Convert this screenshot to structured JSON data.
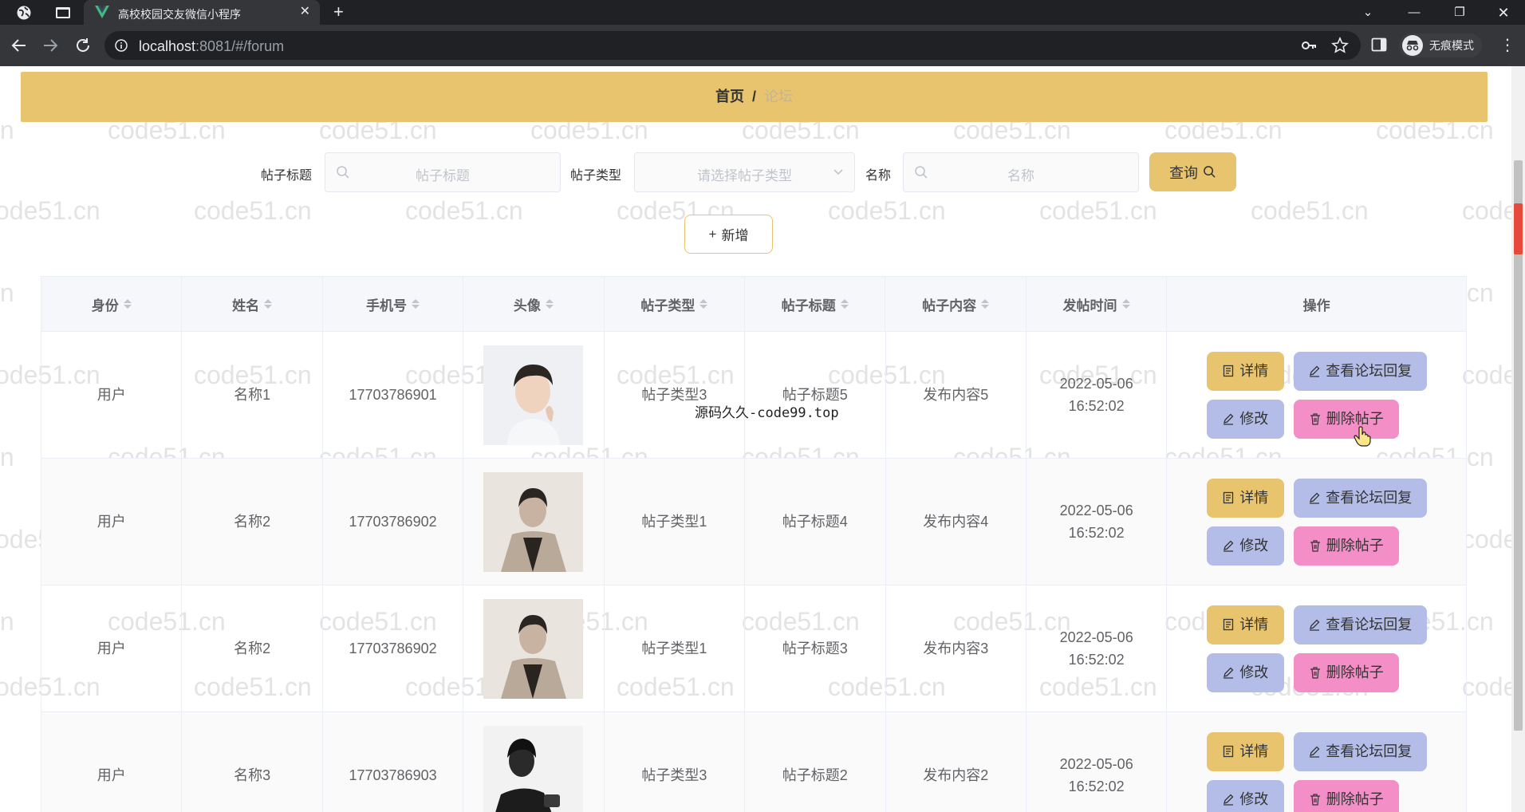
{
  "browser": {
    "tab_title": "高校校园交友微信小程序",
    "tab_close": "✕",
    "new_tab": "+",
    "url_host": "localhost",
    "url_path": ":8081/#/forum",
    "incognito_label": "无痕模式",
    "accent_color": "#42b883"
  },
  "breadcrumb": {
    "home": "首页",
    "separator": "/",
    "current": "论坛"
  },
  "search": {
    "title_label": "帖子标题",
    "title_placeholder": "帖子标题",
    "type_label": "帖子类型",
    "type_placeholder": "请选择帖子类型",
    "name_label": "名称",
    "name_placeholder": "名称",
    "query_button": "查询"
  },
  "toolbar": {
    "add_button": "新增",
    "add_icon": "+"
  },
  "table": {
    "columns": [
      "身份",
      "姓名",
      "手机号",
      "头像",
      "帖子类型",
      "帖子标题",
      "帖子内容",
      "发帖时间",
      "操作"
    ],
    "rows": [
      {
        "role": "用户",
        "name": "名称1",
        "phone": "17703786901",
        "avatar": "portrait-light",
        "post_type": "帖子类型3",
        "post_title": "帖子标题5",
        "post_content": "发布内容5",
        "post_time": "2022-05-06 16:52:02"
      },
      {
        "role": "用户",
        "name": "名称2",
        "phone": "17703786902",
        "avatar": "portrait-coat",
        "post_type": "帖子类型1",
        "post_title": "帖子标题4",
        "post_content": "发布内容4",
        "post_time": "2022-05-06 16:52:02"
      },
      {
        "role": "用户",
        "name": "名称2",
        "phone": "17703786902",
        "avatar": "portrait-coat",
        "post_type": "帖子类型1",
        "post_title": "帖子标题3",
        "post_content": "发布内容3",
        "post_time": "2022-05-06 16:52:02"
      },
      {
        "role": "用户",
        "name": "名称3",
        "phone": "17703786903",
        "avatar": "portrait-dark",
        "post_type": "帖子类型3",
        "post_title": "帖子标题2",
        "post_content": "发布内容2",
        "post_time": "2022-05-06 16:52:02"
      }
    ],
    "actions": {
      "detail": "详情",
      "view_replies": "查看论坛回复",
      "edit": "修改",
      "delete": "删除帖子"
    }
  },
  "overlay_text": "源码久久-code99.top",
  "watermark_text": "code51.cn",
  "colors": {
    "primary": "#e8c46f",
    "secondary": "#b3bde8",
    "danger": "#f48ec6"
  }
}
